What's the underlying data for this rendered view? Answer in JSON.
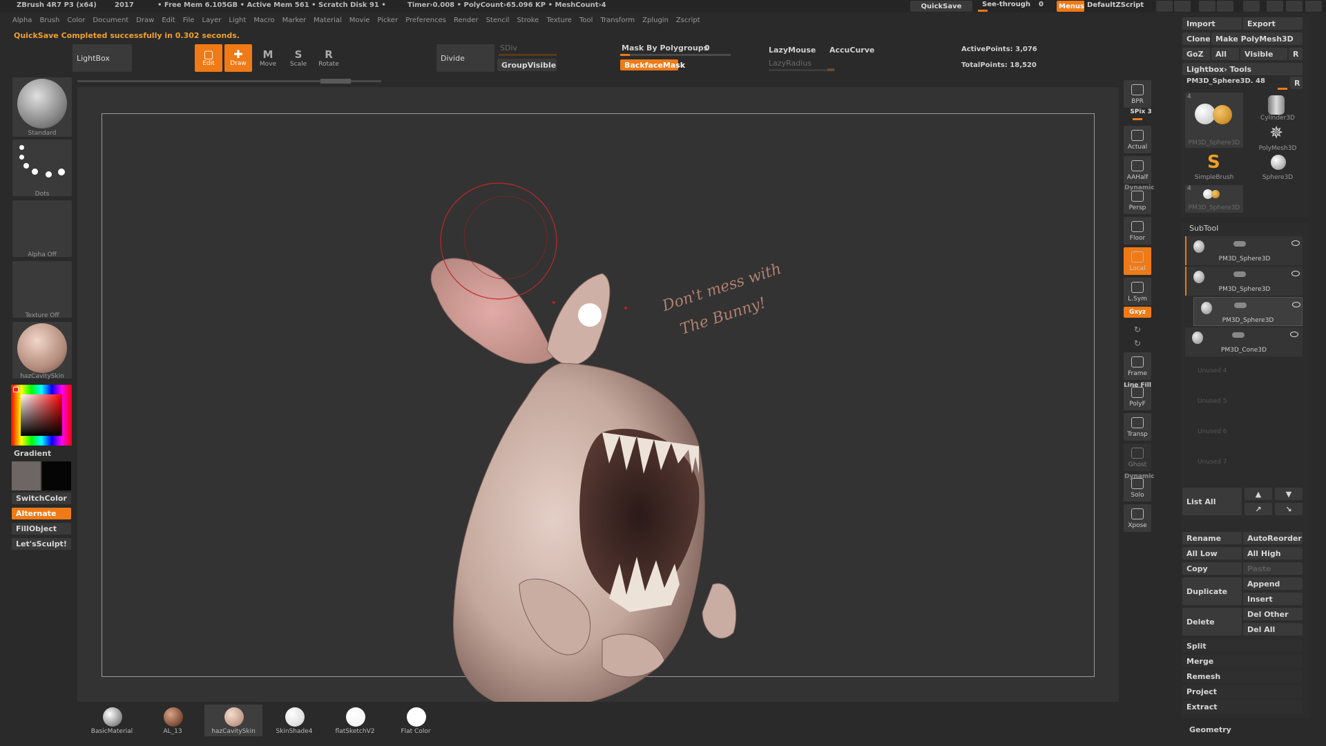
{
  "titlebar": {
    "app": "ZBrush 4R7 P3 (x64)",
    "year": "2017",
    "stats": "• Free Mem 6.105GB • Active Mem 561 • Scratch Disk 91 •",
    "timer": "Timer›0.008 • PolyCount›65.096 KP • MeshCount›4",
    "quicksave": "QuickSave",
    "see_through": "See-through",
    "see_through_value": "0",
    "menus": "Menus",
    "script": "DefaultZScript"
  },
  "menubar": [
    "Alpha",
    "Brush",
    "Color",
    "Document",
    "Draw",
    "Edit",
    "File",
    "Layer",
    "Light",
    "Macro",
    "Marker",
    "Material",
    "Movie",
    "Picker",
    "Preferences",
    "Render",
    "Stencil",
    "Stroke",
    "Texture",
    "Tool",
    "Transform",
    "Zplugin",
    "Zscript"
  ],
  "notification": "QuickSave Completed successfully in 0.302 seconds.",
  "toolbar": {
    "lightbox": "LightBox",
    "edit": "Edit",
    "draw": "Draw",
    "move": "Move",
    "scale": "Scale",
    "rotate": "Rotate",
    "divide": "Divide",
    "sdiv": "SDiv",
    "group_visible": "GroupVisible",
    "mask_by_polygroups": "Mask By Polygroups",
    "mask_value": "0",
    "backface_mask": "BackfaceMask",
    "lazy_mouse": "LazyMouse",
    "lazy_radius": "LazyRadius",
    "accu_curve": "AccuCurve",
    "active_points": "ActivePoints: 3,076",
    "total_points": "TotalPoints: 18,520"
  },
  "left_shelf": {
    "brush": "Standard",
    "stroke": "Dots",
    "alpha": "Alpha Off",
    "texture": "Texture Off",
    "material": "hazCavitySkin",
    "gradient": "Gradient",
    "switch_color": "SwitchColor",
    "alternate": "Alternate",
    "fill_object": "FillObject",
    "lets_sculpt": "Let'sSculpt!"
  },
  "canvas": {
    "annotation_line1": "Don't mess with",
    "annotation_line2": "The Bunny!"
  },
  "right_shelf": {
    "bpr": "BPR",
    "spix": "SPix 3",
    "actual": "Actual",
    "aahalf": "AAHalf",
    "dynamic": "Dynamic",
    "persp": "Persp",
    "floor": "Floor",
    "local": "Local",
    "lsym": "L.Sym",
    "xyz": "Gxyz",
    "frame": "Frame",
    "line_fill": "Line Fill",
    "polyf": "PolyF",
    "transp": "Transp",
    "ghost": "Ghost",
    "dynamic2": "Dynamic",
    "solo": "Solo",
    "xpose": "Xpose"
  },
  "tool_panel": {
    "import": "Import",
    "export": "Export",
    "clone": "Clone",
    "make_polymesh": "Make PolyMesh3D",
    "goz": "GoZ",
    "all": "All",
    "visible": "Visible",
    "r": "R",
    "lightbox_tools": "Lightbox› Tools",
    "current_tool": "PM3D_Sphere3D. 48",
    "tools": [
      {
        "name": "PM3D_Sphere3D",
        "count": "4"
      },
      {
        "name": "Cylinder3D",
        "count": ""
      },
      {
        "name": "PolyMesh3D",
        "count": ""
      },
      {
        "name": "SimpleBrush",
        "count": ""
      },
      {
        "name": "Sphere3D",
        "count": ""
      },
      {
        "name": "PM3D_Sphere3D",
        "count": "4"
      }
    ],
    "subtool_header": "SubTool",
    "subtools": [
      "PM3D_Sphere3D",
      "PM3D_Sphere3D",
      "PM3D_Sphere3D",
      "PM3D_Cone3D"
    ],
    "unused": [
      "Unused 4",
      "Unused 5",
      "Unused 6",
      "Unused 7"
    ],
    "list_all": "List All",
    "rename": "Rename",
    "auto_reorder": "AutoReorder",
    "all_low": "All Low",
    "all_high": "All High",
    "copy": "Copy",
    "paste": "Paste",
    "duplicate": "Duplicate",
    "append": "Append",
    "insert": "Insert",
    "delete": "Delete",
    "del_other": "Del Other",
    "del_all": "Del All",
    "split": "Split",
    "merge": "Merge",
    "remesh": "Remesh",
    "project": "Project",
    "extract": "Extract",
    "geometry": "Geometry"
  },
  "materials": [
    "BasicMaterial",
    "AL_13",
    "hazCavitySkin",
    "SkinShade4",
    "flatSketchV2",
    "Flat Color"
  ],
  "colors": {
    "accent": "#ef7a16",
    "panel": "#3a3a3a",
    "bg": "#2a2a2a"
  }
}
